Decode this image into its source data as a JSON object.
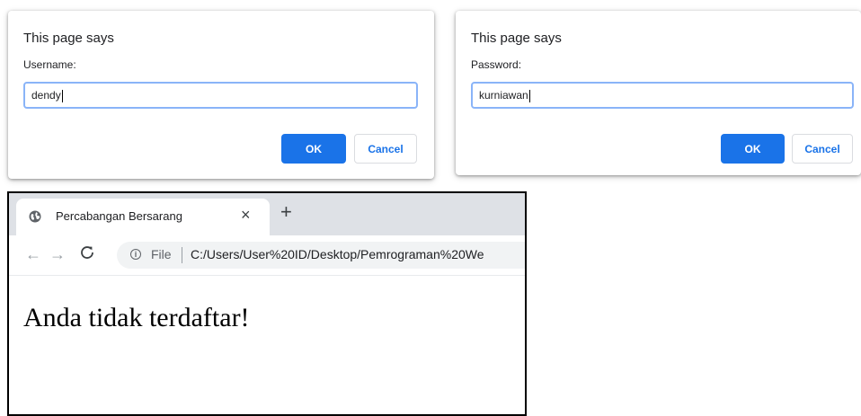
{
  "dialogs": [
    {
      "title": "This page says",
      "label": "Username:",
      "value": "dendy",
      "ok_label": "OK",
      "cancel_label": "Cancel"
    },
    {
      "title": "This page says",
      "label": "Password:",
      "value": "kurniawan",
      "ok_label": "OK",
      "cancel_label": "Cancel"
    }
  ],
  "browser": {
    "tab": {
      "title": "Percabangan Bersarang",
      "favicon": "globe-icon",
      "close": "×"
    },
    "new_tab": "+",
    "nav": {
      "back": "←",
      "forward": "→",
      "reload": "C"
    },
    "address": {
      "scheme_label": "File",
      "url": "C:/Users/User%20ID/Desktop/Pemrograman%20We"
    },
    "content": {
      "message": "Anda tidak terdaftar!"
    }
  },
  "colors": {
    "accent": "#1a73e8",
    "focus_border": "#8ab4f8",
    "tabstrip": "#dee1e6"
  }
}
